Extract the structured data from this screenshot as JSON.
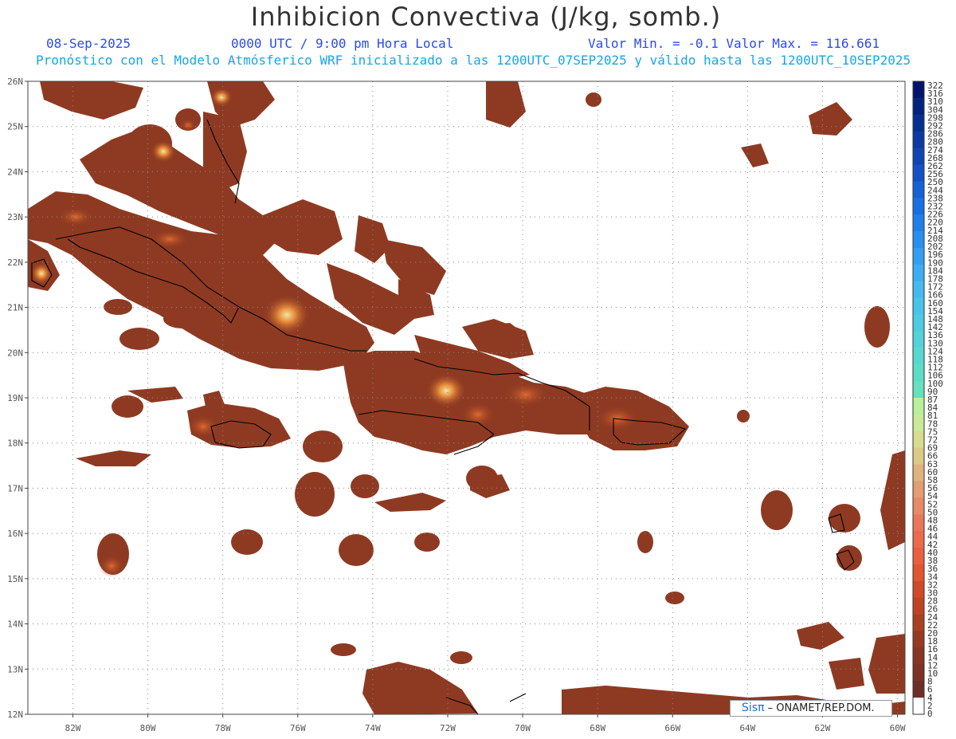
{
  "header": {
    "title": "Inhibicion Convectiva (J/kg, somb.)",
    "date": "08-Sep-2025",
    "time": "0000 UTC / 9:00 pm Hora Local",
    "range": "Valor Min. = -0.1  Valor Max. = 116.661",
    "description": "Pronóstico con el Modelo Atmósferico WRF inicializado a las 1200UTC_07SEP2025 y válido hasta las  1200UTC_10SEP2025"
  },
  "map": {
    "lat_labels": [
      "26N",
      "25N",
      "24N",
      "23N",
      "22N",
      "21N",
      "20N",
      "19N",
      "18N",
      "17N",
      "16N",
      "15N",
      "14N",
      "13N",
      "12N"
    ],
    "lon_labels": [
      "82W",
      "80W",
      "78W",
      "76W",
      "74W",
      "72W",
      "70W",
      "68W",
      "66W",
      "64W",
      "62W",
      "60W"
    ],
    "lat_range": [
      12,
      26
    ],
    "lon_range": [
      -83.2,
      -59.8
    ],
    "fill_color": "#8e3a22",
    "coast_color": "#000000",
    "grid": "dotted"
  },
  "colorbar": {
    "labels": [
      "322",
      "316",
      "310",
      "304",
      "298",
      "292",
      "286",
      "280",
      "274",
      "268",
      "262",
      "256",
      "250",
      "244",
      "238",
      "232",
      "226",
      "220",
      "214",
      "208",
      "202",
      "196",
      "190",
      "184",
      "178",
      "172",
      "166",
      "160",
      "154",
      "148",
      "142",
      "136",
      "130",
      "124",
      "118",
      "112",
      "106",
      "100",
      "90",
      "87",
      "84",
      "81",
      "78",
      "75",
      "72",
      "69",
      "66",
      "63",
      "60",
      "58",
      "56",
      "54",
      "52",
      "50",
      "48",
      "46",
      "44",
      "42",
      "40",
      "38",
      "36",
      "34",
      "32",
      "30",
      "28",
      "26",
      "24",
      "22",
      "20",
      "18",
      "16",
      "14",
      "12",
      "10",
      "8",
      "6",
      "4",
      "2",
      "0"
    ],
    "colors": [
      "#00136e",
      "#02247f",
      "#053090",
      "#0d3aa2",
      "#1044b3",
      "#1251c6",
      "#1462d6",
      "#1771e3",
      "#1f80ea",
      "#2a90ef",
      "#349ff2",
      "#3cadf2",
      "#46b9ef",
      "#4ac3e9",
      "#4ecbe2",
      "#54d2d9",
      "#5ad8d0",
      "#5fdcc6",
      "#66e0bd",
      "#b9ef9d",
      "#cbe996",
      "#d7dc8e",
      "#dcc986",
      "#dfb37d",
      "#e29d72",
      "#e68967",
      "#e8765a",
      "#ea6a4c",
      "#e9603e",
      "#e0562f",
      "#cf4c27",
      "#bd4523",
      "#a94021",
      "#963a22",
      "#883524",
      "#7c3226",
      "#6e2d27",
      "#ffffff"
    ]
  },
  "credit": {
    "logo": "Sisπ",
    "text": "– ONAMET/REP.DOM."
  }
}
